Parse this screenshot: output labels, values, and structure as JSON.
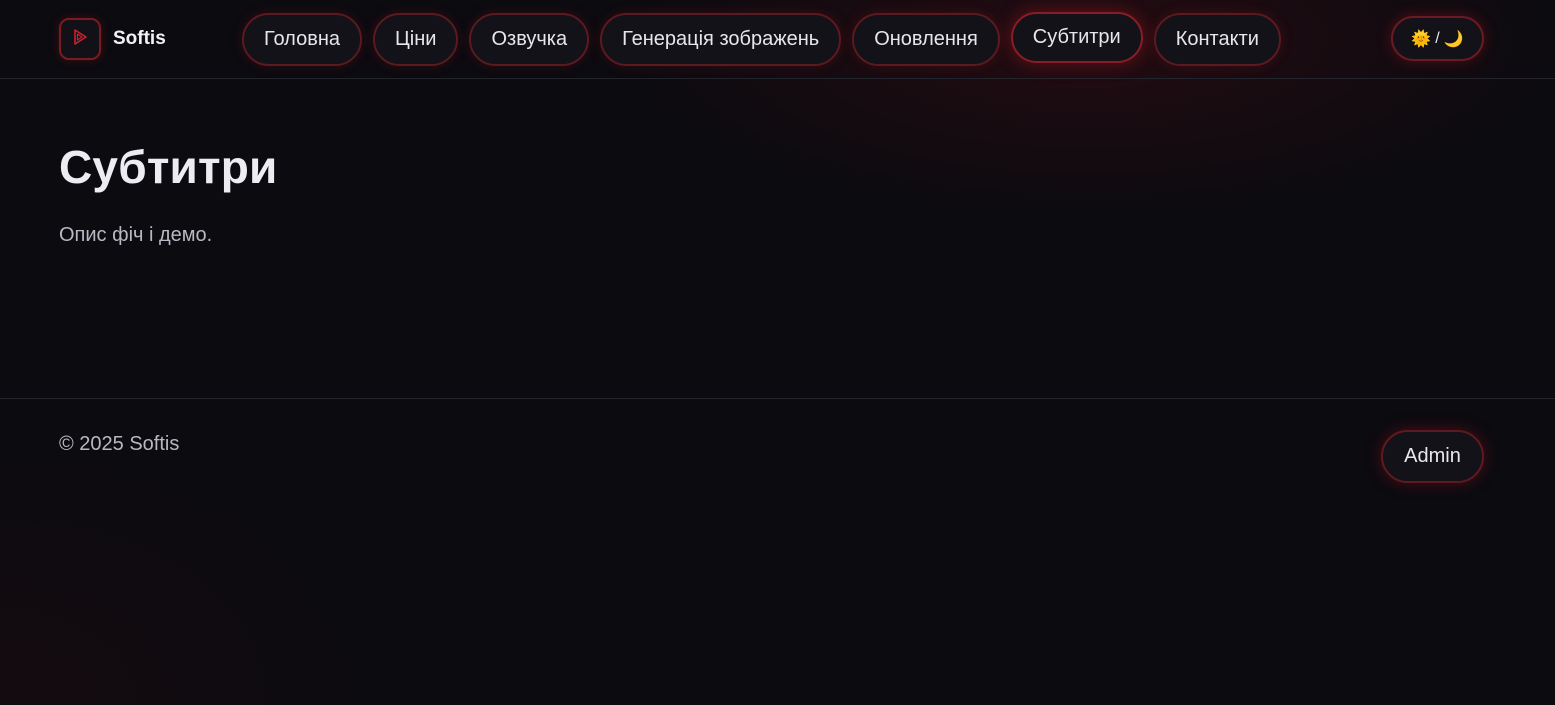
{
  "brand": {
    "name": "Softis",
    "logo_icon": "play-icon"
  },
  "nav": {
    "items": [
      {
        "label": "Головна"
      },
      {
        "label": "Ціни"
      },
      {
        "label": "Озвучка"
      },
      {
        "label": "Генерація зображень"
      },
      {
        "label": "Оновлення"
      },
      {
        "label": "Субтитри",
        "active": true
      },
      {
        "label": "Контакти"
      }
    ]
  },
  "theme_toggle": {
    "sun": "🌞",
    "separator": "/",
    "moon": "🌙"
  },
  "main": {
    "title": "Субтитри",
    "description": "Опис фіч і демо."
  },
  "footer": {
    "copyright": "© 2025 Softis",
    "admin_label": "Admin"
  },
  "colors": {
    "background": "#0b0b10",
    "accent": "#8a1c26",
    "text": "#e8e8ee"
  }
}
